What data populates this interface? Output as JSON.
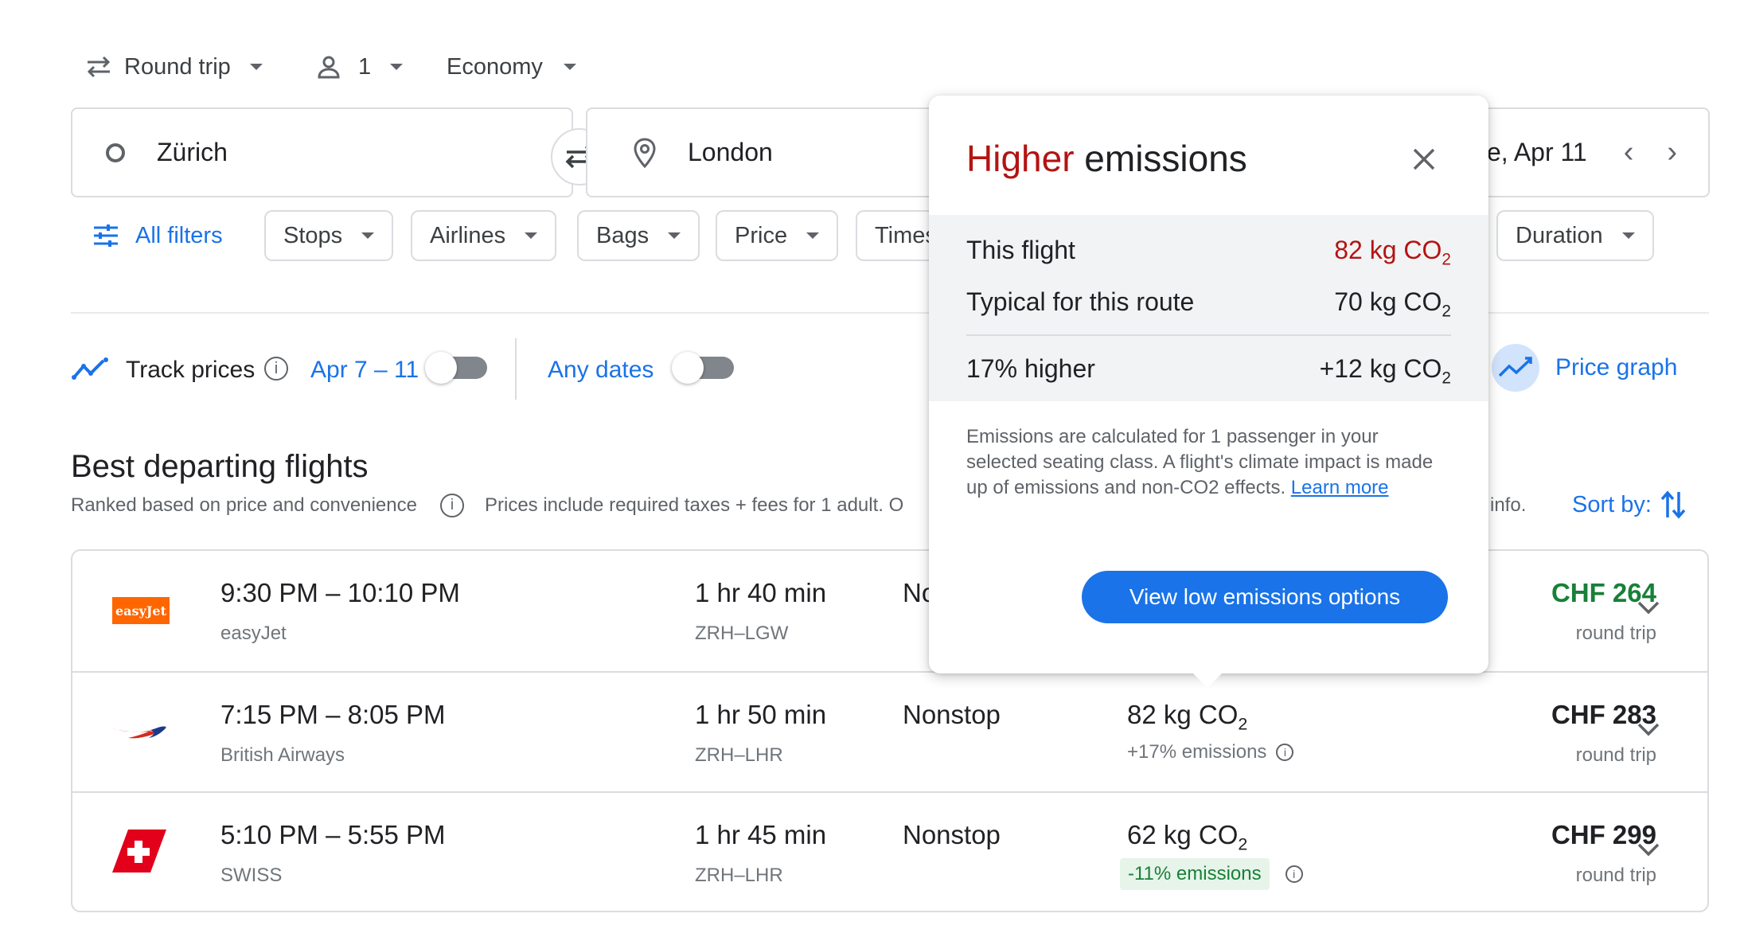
{
  "topbar": {
    "trip_type": "Round trip",
    "passengers": "1",
    "cabin": "Economy"
  },
  "search": {
    "origin": "Zürich",
    "destination": "London",
    "date_fragment": "e, Apr 11"
  },
  "filters": {
    "all_filters": "All filters",
    "chips": [
      "Stops",
      "Airlines",
      "Bags",
      "Price",
      "Times",
      "Duration"
    ]
  },
  "track": {
    "label": "Track prices",
    "date_range": "Apr 7 – 11",
    "any_dates": "Any dates",
    "price_graph": "Price graph"
  },
  "section": {
    "title": "Best departing flights",
    "subtitle": "Ranked based on price and convenience",
    "prices_note": "Prices include required taxes + fees for 1 adult. O",
    "info_tail": "info.",
    "sort_by": "Sort by:"
  },
  "flights": [
    {
      "airline": "easyJet",
      "logo_text": "easyJet",
      "times": "9:30 PM – 10:10 PM",
      "duration": "1 hr 40 min",
      "route": "ZRH–LGW",
      "stops": "No",
      "price": "CHF 264",
      "price_note": "round trip",
      "price_color": "#188038"
    },
    {
      "airline": "British Airways",
      "times": "7:15 PM – 8:05 PM",
      "duration": "1 hr 50 min",
      "route": "ZRH–LHR",
      "stops": "Nonstop",
      "co2_value": "82 kg CO",
      "co2_sub": "2",
      "emissions": "+17% emissions",
      "price": "CHF 283",
      "price_note": "round trip"
    },
    {
      "airline": "SWISS",
      "times": "5:10 PM – 5:55 PM",
      "duration": "1 hr 45 min",
      "route": "ZRH–LHR",
      "stops": "Nonstop",
      "co2_value": "62 kg CO",
      "co2_sub": "2",
      "emissions": "-11% emissions",
      "price": "CHF 299",
      "price_note": "round trip"
    }
  ],
  "popup": {
    "title_highlight": "Higher",
    "title_rest": "emissions",
    "this_flight_label": "This flight",
    "this_flight_value": "82 kg CO",
    "typical_label": "Typical for this route",
    "typical_value": "70 kg CO",
    "diff_label": "17% higher",
    "diff_value": "+12 kg CO",
    "subscript": "2",
    "note": "Emissions are calculated for 1 passenger in your selected seating class. A flight's climate impact is made up of emissions and non-CO2 effects.",
    "learn_more": "Learn more",
    "cta": "View low emissions options"
  },
  "colors": {
    "accent": "#1a73e8",
    "higher_red": "#b31412",
    "green": "#188038",
    "green_bg": "#e6f4ea"
  }
}
